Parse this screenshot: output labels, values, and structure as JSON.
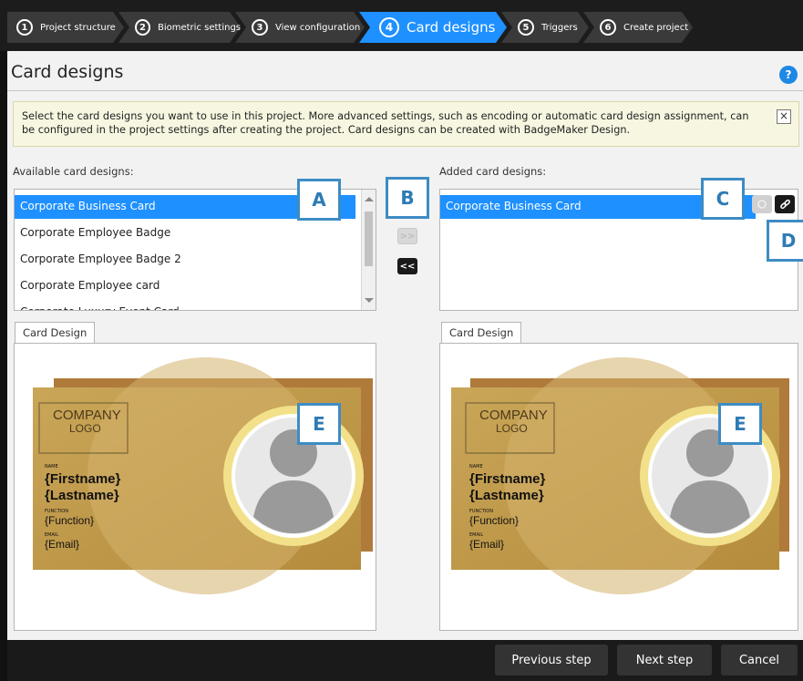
{
  "wizard": {
    "steps": [
      {
        "num": "1",
        "label": "Project structure"
      },
      {
        "num": "2",
        "label": "Biometric settings"
      },
      {
        "num": "3",
        "label": "View configuration"
      },
      {
        "num": "4",
        "label": "Card designs"
      },
      {
        "num": "5",
        "label": "Triggers"
      },
      {
        "num": "6",
        "label": "Create project"
      }
    ],
    "active_step": 4
  },
  "page": {
    "title": "Card designs",
    "help_label": "?"
  },
  "info": {
    "text": "Select the card designs you want to use in this project. More advanced settings, such as encoding or automatic card design assignment, can be configured in the project settings after creating the project. Card designs can be created with BadgeMaker Design.",
    "close_label": "×"
  },
  "available": {
    "label": "Available card designs:",
    "items": [
      "Corporate Business Card",
      "Corporate Employee Badge",
      "Corporate Employee Badge 2",
      "Corporate Employee card",
      "Corporate Luxury Event Card"
    ],
    "selected_index": 0
  },
  "move_buttons": {
    "add_label": ">>",
    "remove_label": "<<"
  },
  "added": {
    "label": "Added card designs:",
    "items": [
      "Corporate Business Card"
    ],
    "selected_index": 0
  },
  "preview_left": {
    "tab_label": "Card Design"
  },
  "preview_right": {
    "tab_label": "Card Design"
  },
  "badge": {
    "logo_line1": "COMPANY",
    "logo_line2": "LOGO",
    "name_caption": "NAME",
    "firstname": "{Firstname}",
    "lastname": "{Lastname}",
    "function_caption": "FUNCTION",
    "function": "{Function}",
    "email_caption": "EMAIL",
    "email": "{Email}"
  },
  "callouts": {
    "a": "A",
    "b": "B",
    "c": "C",
    "d": "D",
    "e1": "E",
    "e2": "E"
  },
  "footer": {
    "previous": "Previous step",
    "next": "Next step",
    "cancel": "Cancel"
  },
  "colors": {
    "accent": "#1e90ff",
    "active_step": "#1e90ff",
    "inactive_step": "#3a3a3a",
    "callout_border": "#3d8cc4",
    "badge_gold": "#c9a24f"
  }
}
